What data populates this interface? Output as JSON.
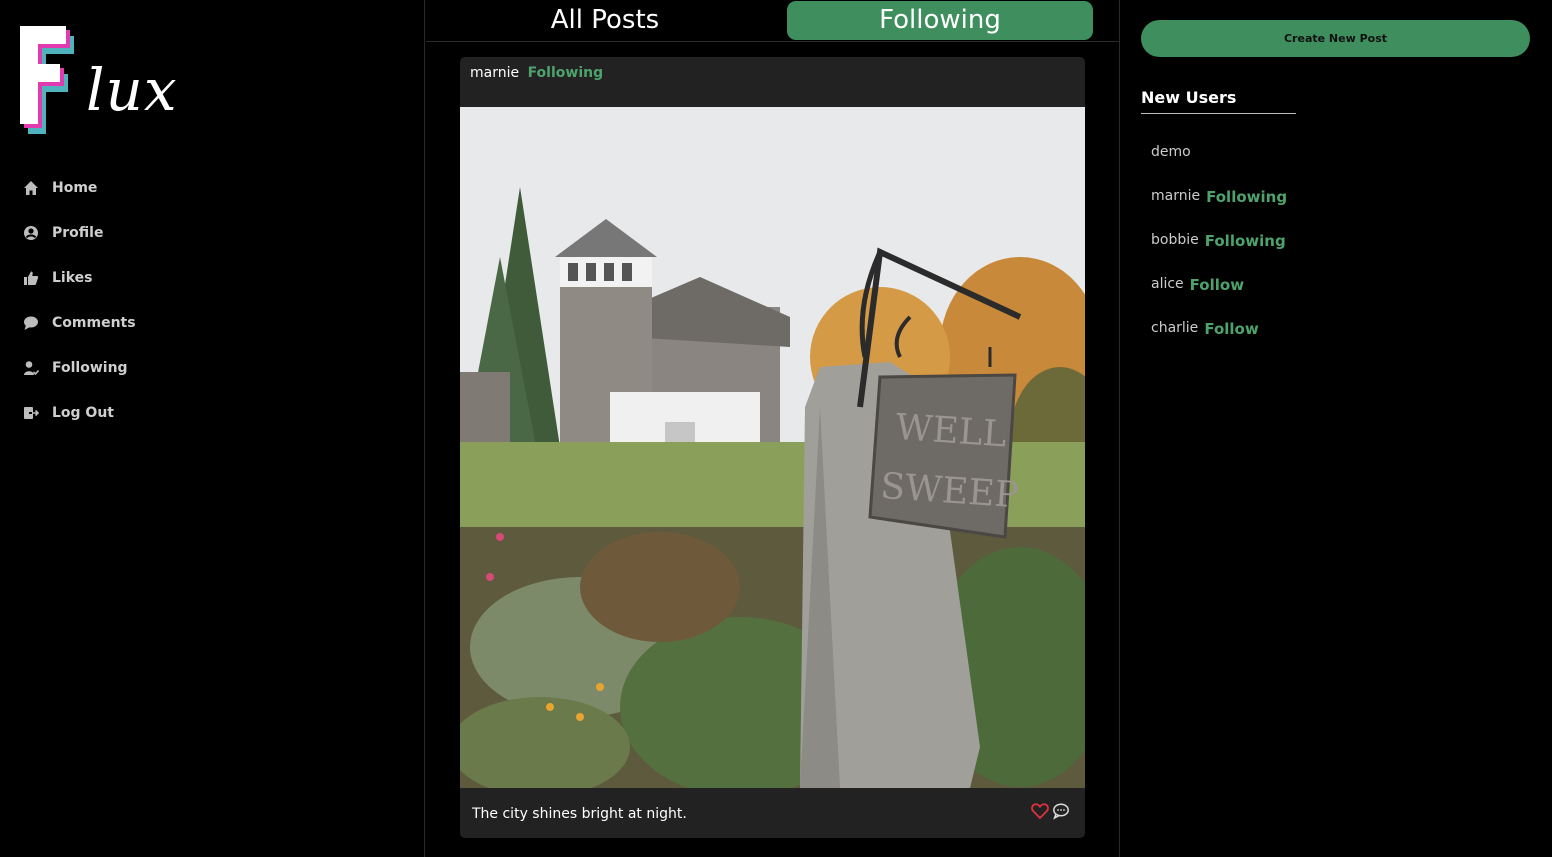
{
  "brand": {
    "name": "lux"
  },
  "nav": {
    "items": [
      {
        "label": "Home",
        "icon": "home-icon"
      },
      {
        "label": "Profile",
        "icon": "user-circle-icon"
      },
      {
        "label": "Likes",
        "icon": "thumbs-up-icon"
      },
      {
        "label": "Comments",
        "icon": "speech-bubble-icon"
      },
      {
        "label": "Following",
        "icon": "user-check-icon"
      },
      {
        "label": "Log Out",
        "icon": "logout-icon"
      }
    ]
  },
  "tabs": {
    "all": "All Posts",
    "following": "Following",
    "active": "following"
  },
  "post": {
    "author": "marnie",
    "status": "Following",
    "caption": "The city shines bright at night.",
    "liked": true
  },
  "sidebar_right": {
    "create_button": "Create New Post",
    "new_users_title": "New Users",
    "users": [
      {
        "name": "demo",
        "relation": ""
      },
      {
        "name": "marnie",
        "relation": "Following"
      },
      {
        "name": "bobbie",
        "relation": "Following"
      },
      {
        "name": "alice",
        "relation": "Follow"
      },
      {
        "name": "charlie",
        "relation": "Follow"
      }
    ]
  },
  "colors": {
    "accent": "#3e8e5e",
    "accent_text": "#4ea36c",
    "heart": "#e0323c",
    "logo_pink": "#e23bb0",
    "logo_teal": "#4fb3bd"
  }
}
